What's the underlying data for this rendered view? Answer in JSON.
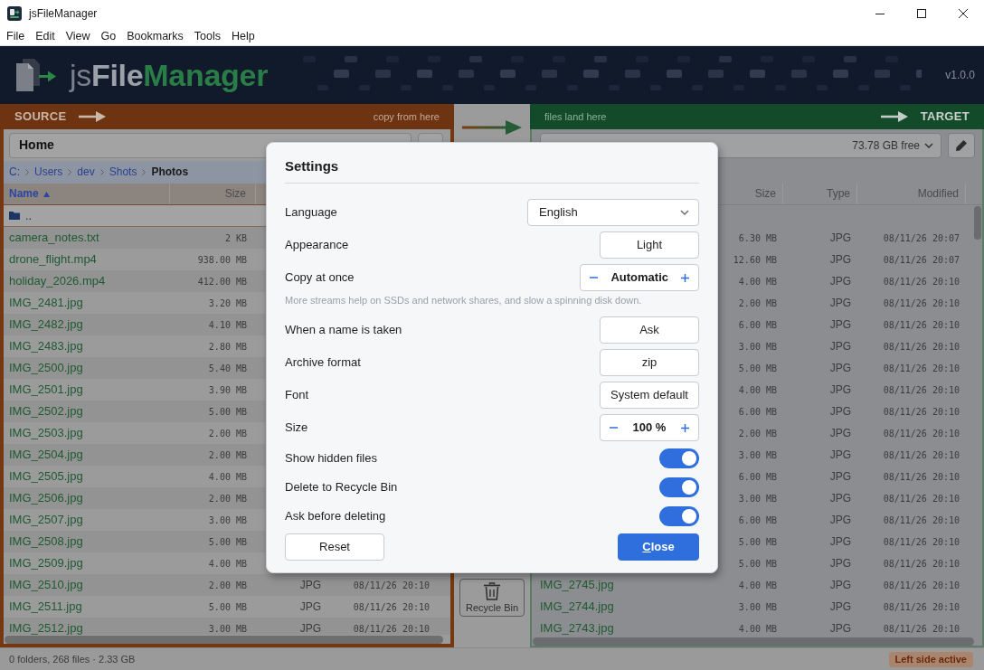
{
  "window": {
    "title": "jsFileManager"
  },
  "menu": [
    "File",
    "Edit",
    "View",
    "Go",
    "Bookmarks",
    "Tools",
    "Help"
  ],
  "banner": {
    "logo": [
      "js",
      "File",
      "Manager"
    ],
    "version": "v1.0.0"
  },
  "source_panel": {
    "title": "SOURCE",
    "hint": "copy from here",
    "location": "Home",
    "breadcrumb": [
      {
        "label": "C:",
        "current": false
      },
      {
        "label": "Users",
        "current": false
      },
      {
        "label": "dev",
        "current": false
      },
      {
        "label": "Shots",
        "current": false
      },
      {
        "label": "Photos",
        "current": true
      }
    ],
    "columns": [
      {
        "label": "Name",
        "sorted": true
      },
      {
        "label": "Size",
        "sorted": false
      }
    ],
    "parent_row": "..",
    "rows": [
      {
        "name": "camera_notes.txt",
        "size": "2 KB"
      },
      {
        "name": "drone_flight.mp4",
        "size": "938.00 MB"
      },
      {
        "name": "holiday_2026.mp4",
        "size": "412.00 MB"
      },
      {
        "name": "IMG_2481.jpg",
        "size": "3.20 MB"
      },
      {
        "name": "IMG_2482.jpg",
        "size": "4.10 MB"
      },
      {
        "name": "IMG_2483.jpg",
        "size": "2.80 MB"
      },
      {
        "name": "IMG_2500.jpg",
        "size": "5.40 MB"
      },
      {
        "name": "IMG_2501.jpg",
        "size": "3.90 MB"
      },
      {
        "name": "IMG_2502.jpg",
        "size": "5.00 MB"
      },
      {
        "name": "IMG_2503.jpg",
        "size": "2.00 MB"
      },
      {
        "name": "IMG_2504.jpg",
        "size": "2.00 MB"
      },
      {
        "name": "IMG_2505.jpg",
        "size": "4.00 MB"
      },
      {
        "name": "IMG_2506.jpg",
        "size": "2.00 MB"
      },
      {
        "name": "IMG_2507.jpg",
        "size": "3.00 MB"
      },
      {
        "name": "IMG_2508.jpg",
        "size": "5.00 MB"
      },
      {
        "name": "IMG_2509.jpg",
        "size": "4.00 MB"
      },
      {
        "name": "IMG_2510.jpg",
        "size": "2.00 MB",
        "type": "JPG",
        "modified": "08/11/26 20:10"
      },
      {
        "name": "IMG_2511.jpg",
        "size": "5.00 MB",
        "type": "JPG",
        "modified": "08/11/26 20:10"
      },
      {
        "name": "IMG_2512.jpg",
        "size": "3.00 MB",
        "type": "JPG",
        "modified": "08/11/26 20:10"
      }
    ]
  },
  "transfer": {
    "recycle_bin": "Recycle Bin"
  },
  "target_panel": {
    "title": "TARGET",
    "hint": "files land here",
    "free_space": "73.78 GB free",
    "columns": [
      {
        "label": "Size"
      },
      {
        "label": "Type"
      },
      {
        "label": "Modified"
      }
    ],
    "rows": [
      {
        "size": "6.30 MB",
        "type": "JPG",
        "modified": "08/11/26 20:07"
      },
      {
        "size": "12.60 MB",
        "type": "JPG",
        "modified": "08/11/26 20:07"
      },
      {
        "size": "4.00 MB",
        "type": "JPG",
        "modified": "08/11/26 20:10"
      },
      {
        "size": "2.00 MB",
        "type": "JPG",
        "modified": "08/11/26 20:10"
      },
      {
        "size": "6.00 MB",
        "type": "JPG",
        "modified": "08/11/26 20:10"
      },
      {
        "size": "3.00 MB",
        "type": "JPG",
        "modified": "08/11/26 20:10"
      },
      {
        "size": "5.00 MB",
        "type": "JPG",
        "modified": "08/11/26 20:10"
      },
      {
        "size": "4.00 MB",
        "type": "JPG",
        "modified": "08/11/26 20:10"
      },
      {
        "size": "6.00 MB",
        "type": "JPG",
        "modified": "08/11/26 20:10"
      },
      {
        "size": "2.00 MB",
        "type": "JPG",
        "modified": "08/11/26 20:10"
      },
      {
        "size": "3.00 MB",
        "type": "JPG",
        "modified": "08/11/26 20:10"
      },
      {
        "size": "6.00 MB",
        "type": "JPG",
        "modified": "08/11/26 20:10"
      },
      {
        "size": "3.00 MB",
        "type": "JPG",
        "modified": "08/11/26 20:10"
      },
      {
        "size": "6.00 MB",
        "type": "JPG",
        "modified": "08/11/26 20:10"
      },
      {
        "size": "5.00 MB",
        "type": "JPG",
        "modified": "08/11/26 20:10"
      },
      {
        "size": "5.00 MB",
        "type": "JPG",
        "modified": "08/11/26 20:10"
      },
      {
        "name": "IMG_2745.jpg",
        "size": "4.00 MB",
        "type": "JPG",
        "modified": "08/11/26 20:10"
      },
      {
        "name": "IMG_2744.jpg",
        "size": "3.00 MB",
        "type": "JPG",
        "modified": "08/11/26 20:10"
      },
      {
        "name": "IMG_2743.jpg",
        "size": "4.00 MB",
        "type": "JPG",
        "modified": "08/11/26 20:10"
      }
    ]
  },
  "status_bar": {
    "summary": "0 folders, 268 files · 2.33 GB",
    "active_side": "Left side active"
  },
  "settings": {
    "title": "Settings",
    "rows": [
      {
        "kind": "select",
        "label": "Language",
        "value": "English"
      },
      {
        "kind": "choice",
        "label": "Appearance",
        "value": "Light"
      },
      {
        "kind": "stepper",
        "label": "Copy at once",
        "value": "Automatic",
        "hint": "More streams help on SSDs and network shares, and slow a spinning disk down."
      },
      {
        "kind": "choice",
        "label": "When a name is taken",
        "value": "Ask"
      },
      {
        "kind": "choice",
        "label": "Archive format",
        "value": "zip"
      },
      {
        "kind": "choice",
        "label": "Font",
        "value": "System default"
      },
      {
        "kind": "stepper",
        "label": "Size",
        "value": "100 %"
      },
      {
        "kind": "toggle",
        "label": "Show hidden files",
        "on": true
      },
      {
        "kind": "toggle",
        "label": "Delete to Recycle Bin",
        "on": true
      },
      {
        "kind": "toggle",
        "label": "Ask before deleting",
        "on": true
      }
    ],
    "buttons": [
      {
        "label": "Reset",
        "primary": false
      },
      {
        "label": "Close",
        "primary": true
      }
    ]
  }
}
